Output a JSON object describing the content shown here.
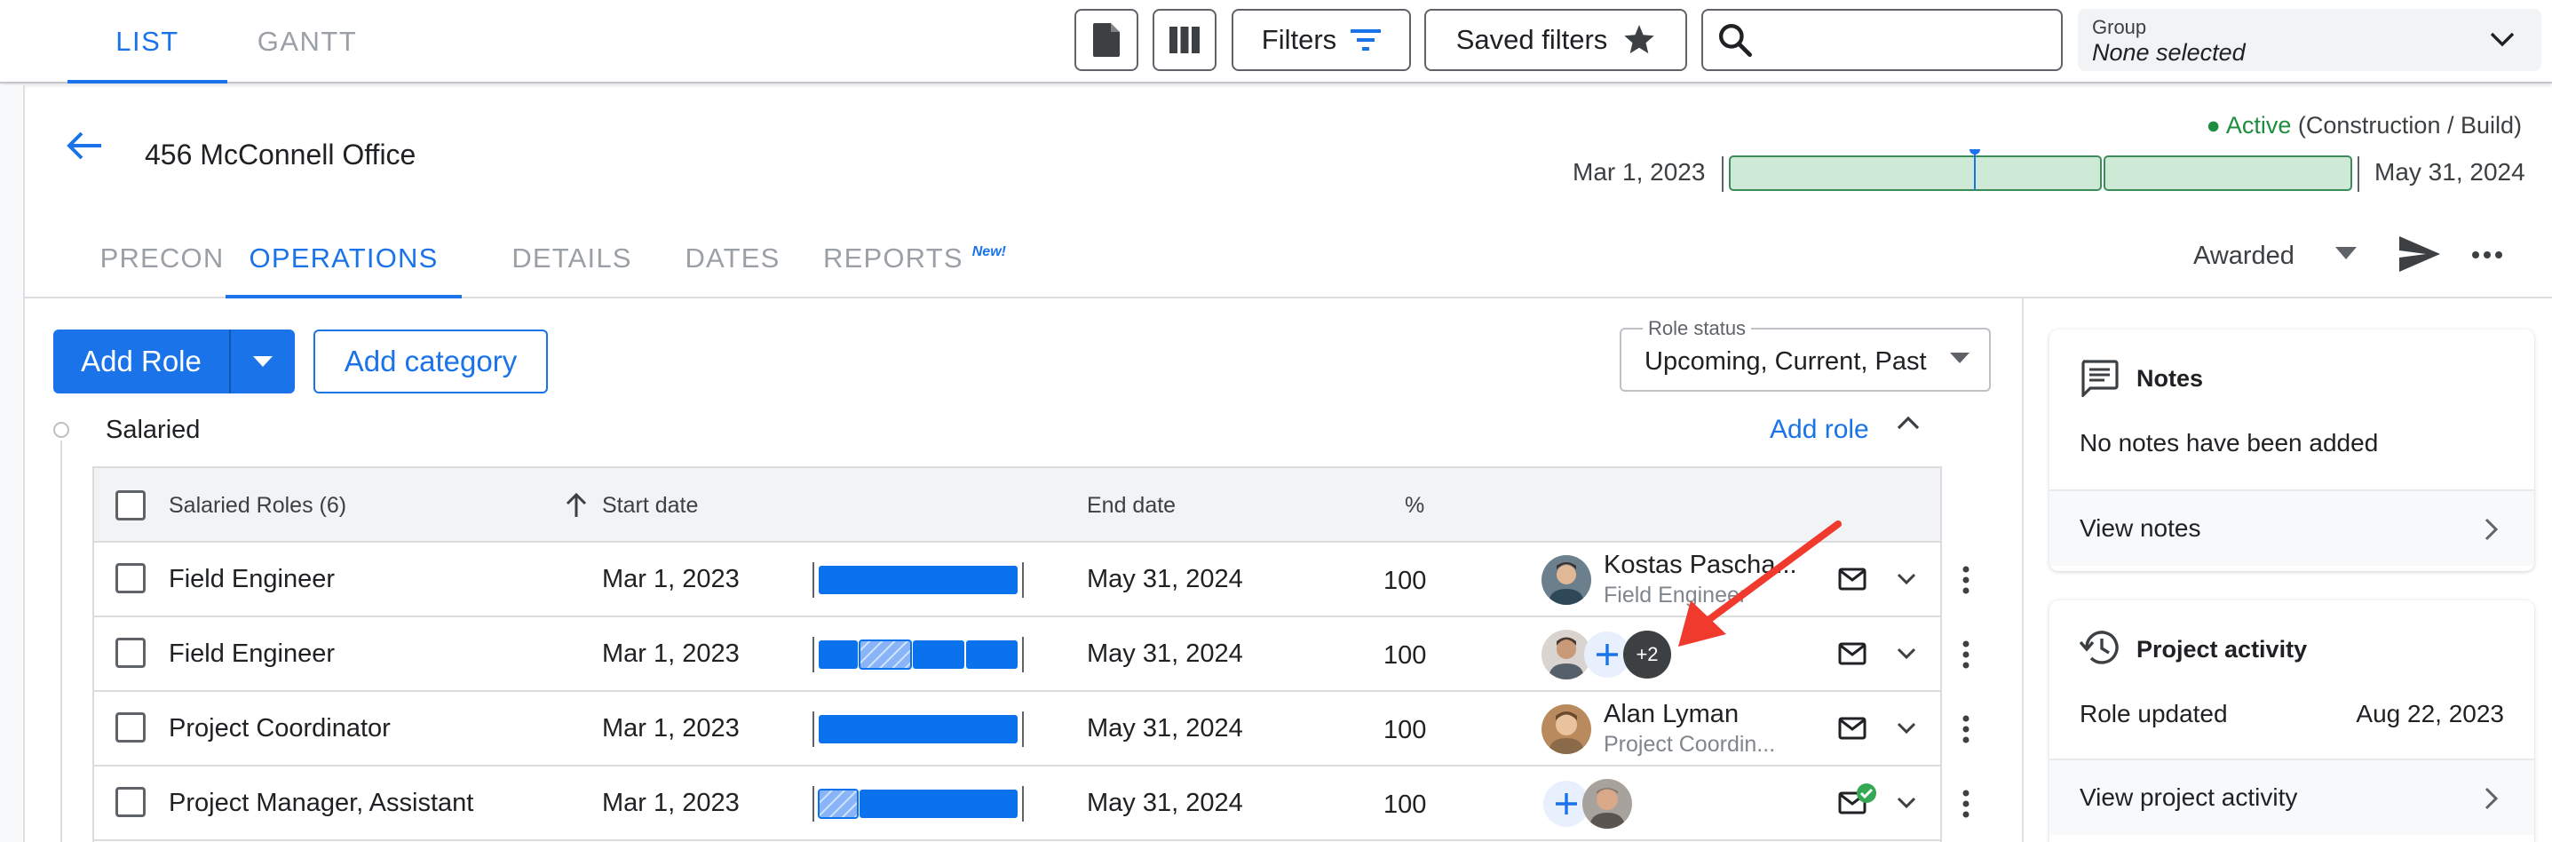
{
  "topbar": {
    "tabs": [
      {
        "label": "LIST",
        "active": true
      },
      {
        "label": "GANTT",
        "active": false
      }
    ],
    "filters_label": "Filters",
    "saved_filters_label": "Saved filters",
    "search_placeholder": "",
    "group": {
      "label": "Group",
      "value": "None selected"
    }
  },
  "project": {
    "name": "456 McConnell Office",
    "status": "Active",
    "status_detail": "(Construction / Build)",
    "start_date": "Mar 1, 2023",
    "end_date": "May 31, 2024",
    "status_color": "#1e8e3e"
  },
  "section_tabs": [
    {
      "label": "PRECON",
      "active": false
    },
    {
      "label": "OPERATIONS",
      "active": true
    },
    {
      "label": "DETAILS",
      "active": false
    },
    {
      "label": "DATES",
      "active": false
    },
    {
      "label": "REPORTS",
      "active": false,
      "badge": "New!"
    }
  ],
  "stage": {
    "value": "Awarded"
  },
  "toolbar": {
    "add_role_label": "Add Role",
    "add_category_label": "Add category",
    "role_status_label": "Role status",
    "role_status_value": "Upcoming, Current, Past"
  },
  "category": {
    "title": "Salaried",
    "add_role_label": "Add role",
    "columns": {
      "roles": "Salaried Roles (6)",
      "start": "Start date",
      "end": "End date",
      "percent": "%"
    },
    "rows": [
      {
        "role": "Field Engineer",
        "start": "Mar 1, 2023",
        "end": "May 31, 2024",
        "percent": "100",
        "person": "Kostas Pascha...",
        "person_title": "Field Engineer"
      },
      {
        "role": "Field Engineer",
        "start": "Mar 1, 2023",
        "end": "May 31, 2024",
        "percent": "100",
        "more_count": "+2"
      },
      {
        "role": "Project Coordinator",
        "start": "Mar 1, 2023",
        "end": "May 31, 2024",
        "percent": "100",
        "person": "Alan Lyman",
        "person_title": "Project Coordin..."
      },
      {
        "role": "Project Manager, Assistant",
        "start": "Mar 1, 2023",
        "end": "May 31, 2024",
        "percent": "100"
      }
    ]
  },
  "notes": {
    "title": "Notes",
    "empty_text": "No notes have been added",
    "view_label": "View notes"
  },
  "activity": {
    "title": "Project activity",
    "item_label": "Role updated",
    "item_date": "Aug 22, 2023",
    "view_label": "View project activity"
  },
  "colors": {
    "accent": "#1a73e8",
    "annotation_arrow": "#f03a2e"
  }
}
